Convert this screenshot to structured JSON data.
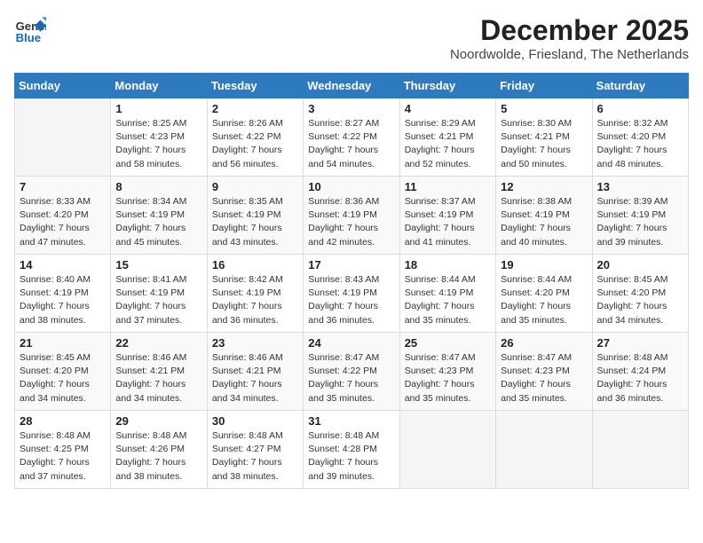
{
  "header": {
    "logo_line1": "General",
    "logo_line2": "Blue",
    "month": "December 2025",
    "location": "Noordwolde, Friesland, The Netherlands"
  },
  "weekdays": [
    "Sunday",
    "Monday",
    "Tuesday",
    "Wednesday",
    "Thursday",
    "Friday",
    "Saturday"
  ],
  "weeks": [
    [
      {
        "day": "",
        "info": ""
      },
      {
        "day": "1",
        "info": "Sunrise: 8:25 AM\nSunset: 4:23 PM\nDaylight: 7 hours\nand 58 minutes."
      },
      {
        "day": "2",
        "info": "Sunrise: 8:26 AM\nSunset: 4:22 PM\nDaylight: 7 hours\nand 56 minutes."
      },
      {
        "day": "3",
        "info": "Sunrise: 8:27 AM\nSunset: 4:22 PM\nDaylight: 7 hours\nand 54 minutes."
      },
      {
        "day": "4",
        "info": "Sunrise: 8:29 AM\nSunset: 4:21 PM\nDaylight: 7 hours\nand 52 minutes."
      },
      {
        "day": "5",
        "info": "Sunrise: 8:30 AM\nSunset: 4:21 PM\nDaylight: 7 hours\nand 50 minutes."
      },
      {
        "day": "6",
        "info": "Sunrise: 8:32 AM\nSunset: 4:20 PM\nDaylight: 7 hours\nand 48 minutes."
      }
    ],
    [
      {
        "day": "7",
        "info": "Sunrise: 8:33 AM\nSunset: 4:20 PM\nDaylight: 7 hours\nand 47 minutes."
      },
      {
        "day": "8",
        "info": "Sunrise: 8:34 AM\nSunset: 4:19 PM\nDaylight: 7 hours\nand 45 minutes."
      },
      {
        "day": "9",
        "info": "Sunrise: 8:35 AM\nSunset: 4:19 PM\nDaylight: 7 hours\nand 43 minutes."
      },
      {
        "day": "10",
        "info": "Sunrise: 8:36 AM\nSunset: 4:19 PM\nDaylight: 7 hours\nand 42 minutes."
      },
      {
        "day": "11",
        "info": "Sunrise: 8:37 AM\nSunset: 4:19 PM\nDaylight: 7 hours\nand 41 minutes."
      },
      {
        "day": "12",
        "info": "Sunrise: 8:38 AM\nSunset: 4:19 PM\nDaylight: 7 hours\nand 40 minutes."
      },
      {
        "day": "13",
        "info": "Sunrise: 8:39 AM\nSunset: 4:19 PM\nDaylight: 7 hours\nand 39 minutes."
      }
    ],
    [
      {
        "day": "14",
        "info": "Sunrise: 8:40 AM\nSunset: 4:19 PM\nDaylight: 7 hours\nand 38 minutes."
      },
      {
        "day": "15",
        "info": "Sunrise: 8:41 AM\nSunset: 4:19 PM\nDaylight: 7 hours\nand 37 minutes."
      },
      {
        "day": "16",
        "info": "Sunrise: 8:42 AM\nSunset: 4:19 PM\nDaylight: 7 hours\nand 36 minutes."
      },
      {
        "day": "17",
        "info": "Sunrise: 8:43 AM\nSunset: 4:19 PM\nDaylight: 7 hours\nand 36 minutes."
      },
      {
        "day": "18",
        "info": "Sunrise: 8:44 AM\nSunset: 4:19 PM\nDaylight: 7 hours\nand 35 minutes."
      },
      {
        "day": "19",
        "info": "Sunrise: 8:44 AM\nSunset: 4:20 PM\nDaylight: 7 hours\nand 35 minutes."
      },
      {
        "day": "20",
        "info": "Sunrise: 8:45 AM\nSunset: 4:20 PM\nDaylight: 7 hours\nand 34 minutes."
      }
    ],
    [
      {
        "day": "21",
        "info": "Sunrise: 8:45 AM\nSunset: 4:20 PM\nDaylight: 7 hours\nand 34 minutes."
      },
      {
        "day": "22",
        "info": "Sunrise: 8:46 AM\nSunset: 4:21 PM\nDaylight: 7 hours\nand 34 minutes."
      },
      {
        "day": "23",
        "info": "Sunrise: 8:46 AM\nSunset: 4:21 PM\nDaylight: 7 hours\nand 34 minutes."
      },
      {
        "day": "24",
        "info": "Sunrise: 8:47 AM\nSunset: 4:22 PM\nDaylight: 7 hours\nand 35 minutes."
      },
      {
        "day": "25",
        "info": "Sunrise: 8:47 AM\nSunset: 4:23 PM\nDaylight: 7 hours\nand 35 minutes."
      },
      {
        "day": "26",
        "info": "Sunrise: 8:47 AM\nSunset: 4:23 PM\nDaylight: 7 hours\nand 35 minutes."
      },
      {
        "day": "27",
        "info": "Sunrise: 8:48 AM\nSunset: 4:24 PM\nDaylight: 7 hours\nand 36 minutes."
      }
    ],
    [
      {
        "day": "28",
        "info": "Sunrise: 8:48 AM\nSunset: 4:25 PM\nDaylight: 7 hours\nand 37 minutes."
      },
      {
        "day": "29",
        "info": "Sunrise: 8:48 AM\nSunset: 4:26 PM\nDaylight: 7 hours\nand 38 minutes."
      },
      {
        "day": "30",
        "info": "Sunrise: 8:48 AM\nSunset: 4:27 PM\nDaylight: 7 hours\nand 38 minutes."
      },
      {
        "day": "31",
        "info": "Sunrise: 8:48 AM\nSunset: 4:28 PM\nDaylight: 7 hours\nand 39 minutes."
      },
      {
        "day": "",
        "info": ""
      },
      {
        "day": "",
        "info": ""
      },
      {
        "day": "",
        "info": ""
      }
    ]
  ]
}
